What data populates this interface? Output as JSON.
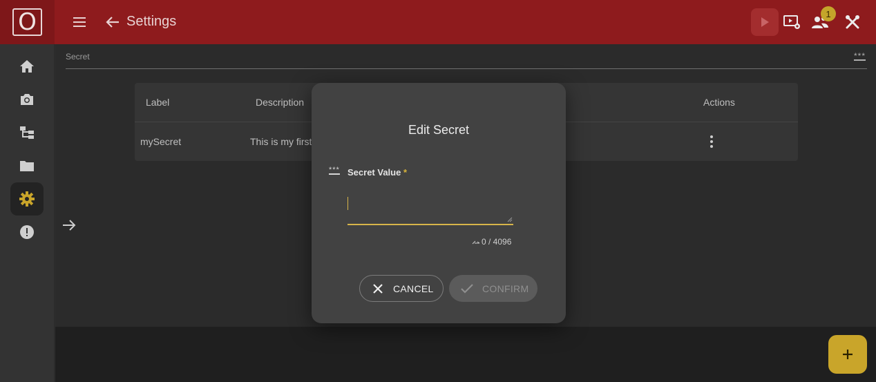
{
  "app": {
    "logo_text": "O",
    "page_title": "Settings",
    "notification_count": "1"
  },
  "icons": {
    "menu": "menu-icon",
    "back": "arrow-left-icon",
    "play": "play-icon",
    "video_settings": "video-settings-icon",
    "users": "users-icon",
    "tools": "tools-icon",
    "home": "home-icon",
    "camera": "camera-icon",
    "hierarchy": "hierarchy-icon",
    "folder": "folder-icon",
    "settings": "gear-icon",
    "alert": "alert-icon",
    "expand": "arrow-right-icon",
    "add": "plus-icon"
  },
  "secret_section": {
    "label": "Secret",
    "stars": "***"
  },
  "table": {
    "columns": [
      "Label",
      "Description",
      "Actions"
    ],
    "rows": [
      {
        "label": "mySecret",
        "description": "This is my first"
      }
    ]
  },
  "dialog": {
    "title": "Edit Secret",
    "field_stars": "***",
    "field_label": "Secret Value",
    "required_mark": "*",
    "value": "",
    "counter": "0 / 4096",
    "cancel_label": "CANCEL",
    "confirm_label": "CONFIRM"
  },
  "colors": {
    "topbar": "#8e1b1d",
    "accent": "#c9a52a",
    "dialog_bg": "#424242"
  }
}
